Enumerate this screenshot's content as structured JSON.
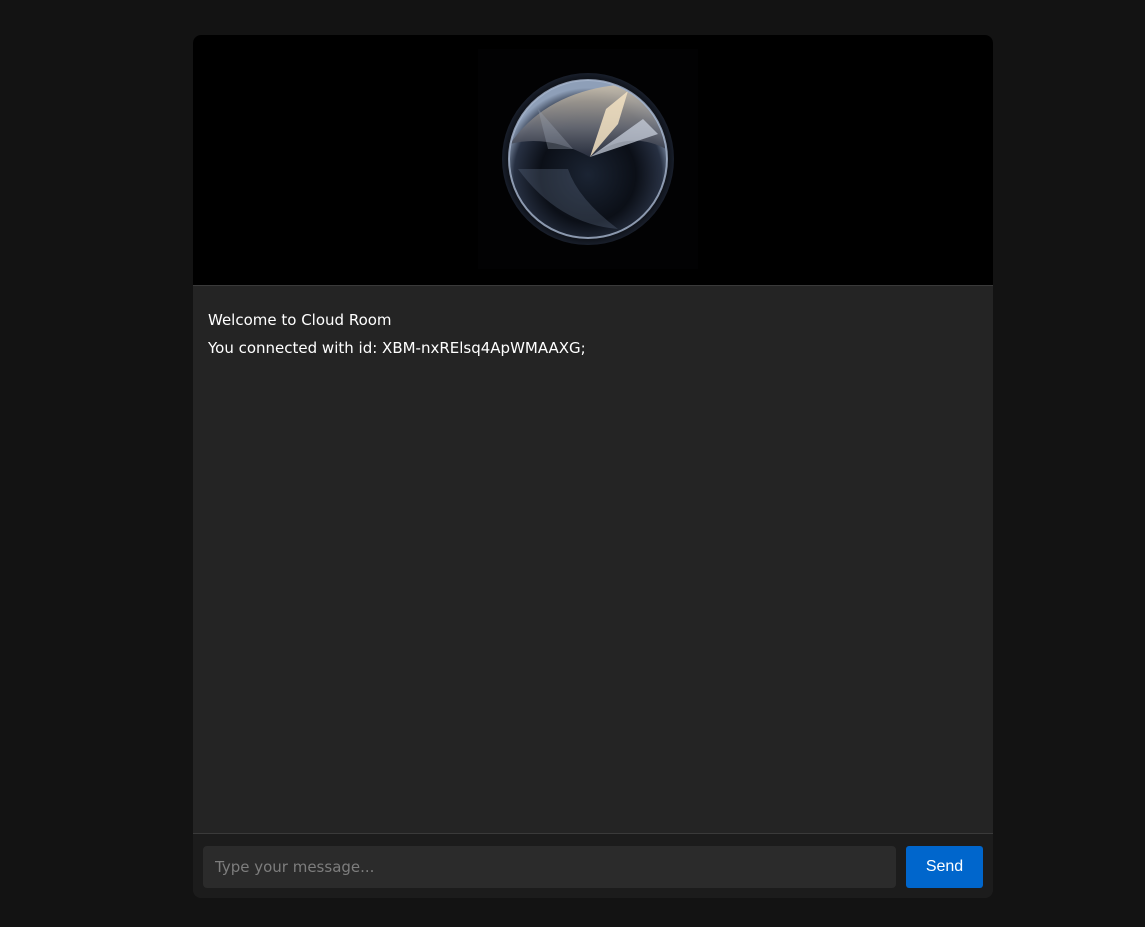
{
  "colors": {
    "page_background": "#131313",
    "messages_background": "#242424",
    "input_background": "#2b2b2b",
    "accent": "#0066cc",
    "text": "#ffffff",
    "placeholder": "#7d7d7d"
  },
  "hero": {
    "image_icon": "glass-orb-image"
  },
  "messages": [
    {
      "text": "Welcome to Cloud Room"
    },
    {
      "text": "You connected with id: XBM-nxRElsq4ApWMAAXG;"
    }
  ],
  "composer": {
    "input_value": "",
    "input_placeholder": "Type your message...",
    "send_label": "Send"
  }
}
